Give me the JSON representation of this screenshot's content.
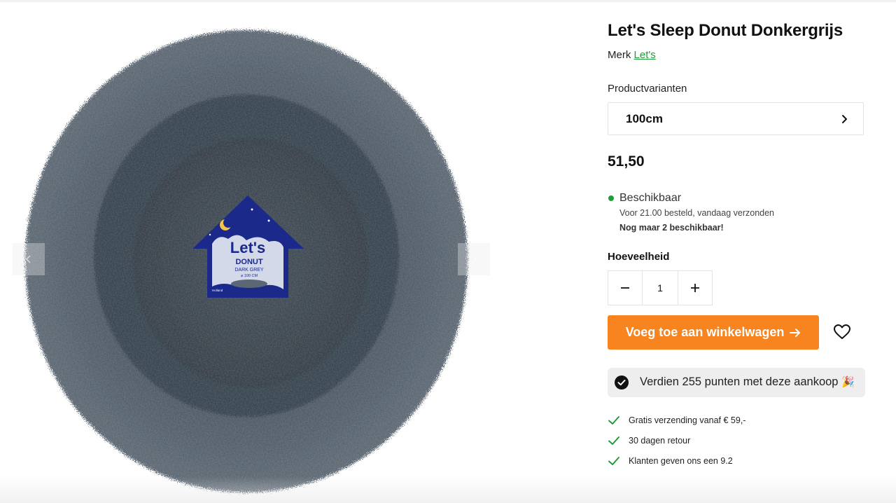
{
  "product": {
    "title": "Let's Sleep Donut Donkergrijs",
    "brand_label": "Merk",
    "brand_name": "Let's",
    "variants_label": "Productvarianten",
    "variant_selected": "100cm",
    "price": "51,50",
    "availability": {
      "status": "Beschikbaar",
      "note": "Voor 21.00 besteld, vandaag verzonden",
      "stock": "Nog maar 2 beschikbaar!",
      "color": "#1f9d3a"
    },
    "quantity_label": "Hoeveelheid",
    "quantity": "1",
    "add_to_cart": "Voeg toe aan winkelwagen",
    "points_text": "Verdien 255 punten met deze aankoop",
    "points_emoji": "🎉",
    "usps": [
      "Gratis verzending vanaf € 59,-",
      "30 dagen retour",
      "Klanten geven ons een 9.2"
    ]
  },
  "image": {
    "tag_lines": [
      "Let's",
      "DONUT",
      "DARK GREY",
      "⌀ 100 CM"
    ],
    "tag_brand": "Holland"
  },
  "colors": {
    "accent": "#f7841e",
    "link": "#1f9d3a",
    "tag_blue": "#1b2a8a",
    "fur": "#3c4751"
  },
  "icons": {
    "gallery_prev": "chevron-left-icon",
    "gallery_next": "chevron-right-icon",
    "variant": "chevron-right-icon",
    "qty_minus": "minus-icon",
    "qty_plus": "plus-icon",
    "cart_arrow": "arrow-right-icon",
    "wishlist": "heart-icon",
    "points": "check-circle-icon",
    "usp": "check-icon"
  }
}
